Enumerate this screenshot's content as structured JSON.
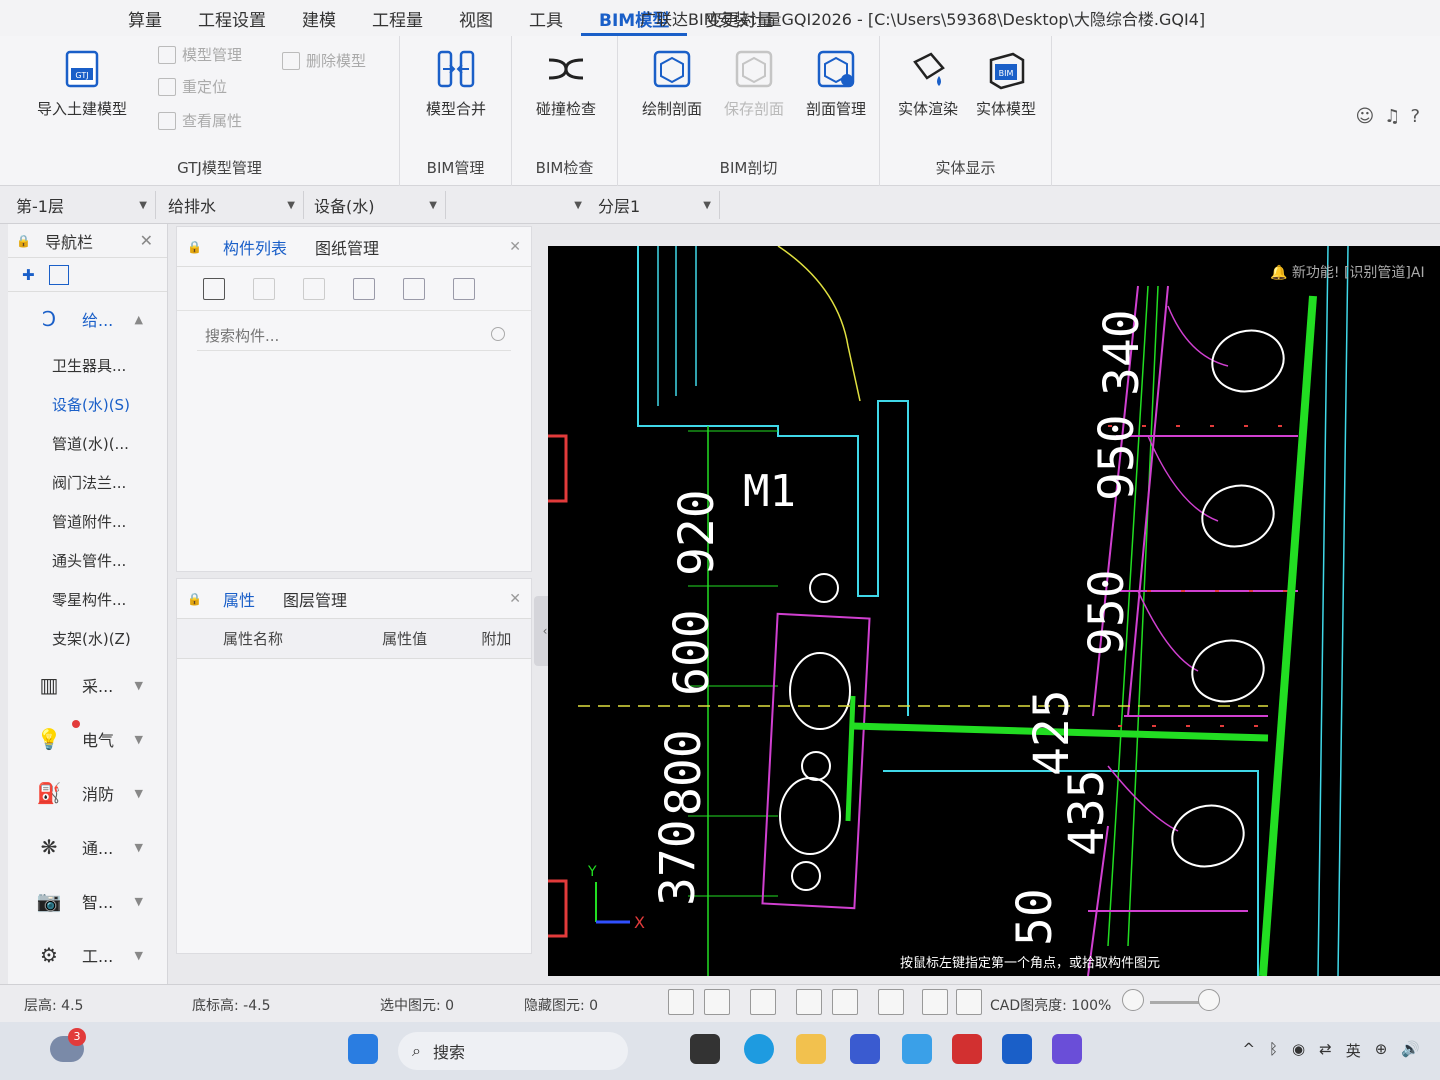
{
  "menu": {
    "items": [
      {
        "label": "算量"
      },
      {
        "label": "工程设置"
      },
      {
        "label": "建模"
      },
      {
        "label": "工程量"
      },
      {
        "label": "视图"
      },
      {
        "label": "工具"
      },
      {
        "label": "BIM模型",
        "active": true
      },
      {
        "label": "变更对量"
      }
    ],
    "window_title": "广联达BIM安装计量GQI2026 - [C:\\Users\\59368\\Desktop\\大隐综合楼.GQI4]"
  },
  "ribbon": {
    "gtj": {
      "import_label": "导入土建模型",
      "model_manage": "模型管理",
      "delete_model": "删除模型",
      "relocate": "重定位",
      "view_props": "查看属性",
      "group_label": "GTJ模型管理"
    },
    "bim_manage": {
      "merge_label": "模型合并",
      "group_label": "BIM管理"
    },
    "bim_check": {
      "collision_label": "碰撞检查",
      "group_label": "BIM检查"
    },
    "bim_section": {
      "draw_section": "绘制剖面",
      "save_section": "保存剖面",
      "section_manage": "剖面管理",
      "group_label": "BIM剖切"
    },
    "solid_display": {
      "render": "实体渲染",
      "solid_model": "实体模型",
      "group_label": "实体显示"
    },
    "gtj_icon_text": "GTJ",
    "bim_icon_text": "BIM"
  },
  "toolbar": {
    "floor": "第-1层",
    "discipline": "给排水",
    "type": "设备(水)",
    "layer": "分层1"
  },
  "nav": {
    "title": "导航栏",
    "categories": [
      {
        "label": "给..."
      },
      {
        "label": "采..."
      },
      {
        "label": "电气"
      },
      {
        "label": "消防"
      },
      {
        "label": "通..."
      },
      {
        "label": "智..."
      },
      {
        "label": "工..."
      }
    ],
    "subitems": [
      {
        "label": "卫生器具..."
      },
      {
        "label": "设备(水)(S)"
      },
      {
        "label": "管道(水)(..."
      },
      {
        "label": "阀门法兰..."
      },
      {
        "label": "管道附件..."
      },
      {
        "label": "通头管件..."
      },
      {
        "label": "零星构件..."
      },
      {
        "label": "支架(水)(Z)"
      }
    ]
  },
  "comp_panel": {
    "tab_list": "构件列表",
    "tab_drawings": "图纸管理",
    "search_placeholder": "搜索构件..."
  },
  "prop_panel": {
    "tab_props": "属性",
    "tab_layers": "图层管理",
    "col_name": "属性名称",
    "col_value": "属性值",
    "col_extra": "附加"
  },
  "canvas": {
    "notification": "新功能! [识别管道]AI",
    "hint": "按鼠标左键指定第一个角点，或拾取构件图元",
    "labels": {
      "m1": "M1",
      "d920": "920",
      "d600": "600",
      "d800": "800",
      "d370": "370",
      "d340": "340",
      "d950a": "950",
      "d950b": "950",
      "d425": "425",
      "d435": "435",
      "d50": "50",
      "axis_x": "X",
      "axis_y": "Y"
    }
  },
  "status": {
    "floor_height": "层高: 4.5",
    "base_elev": "底标高: -4.5",
    "selected": "选中图元: 0",
    "hidden": "隐藏图元: 0",
    "cad_brightness": "CAD图亮度: 100%"
  },
  "taskbar": {
    "search": "搜索",
    "weather_badge": "3",
    "tray_lang": "英"
  },
  "colors": {
    "accent": "#1a5fc8",
    "cad_bg": "#000000",
    "pipe_green": "#22dd22",
    "fixture_magenta": "#d040d0",
    "wall_cyan": "#40d8e8"
  }
}
